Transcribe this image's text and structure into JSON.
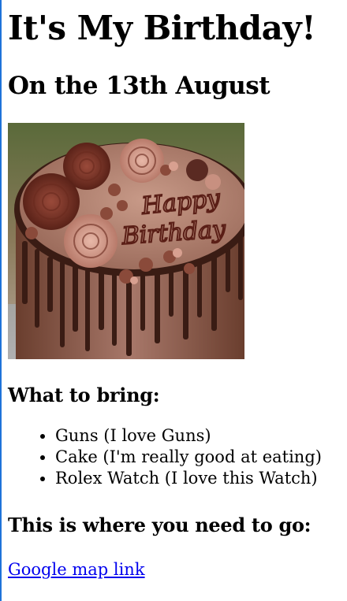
{
  "heading": "It's My Birthday!",
  "subheading": "On the 13th August",
  "image": {
    "name": "birthday-cake-image",
    "cake_text_line1": "Happy",
    "cake_text_line2": "Birthday"
  },
  "bring": {
    "title": "What to bring:",
    "items": [
      "Guns (I love Guns)",
      "Cake (I'm really good at eating)",
      "Rolex Watch (I love this Watch)"
    ]
  },
  "location": {
    "title": "This is where you need to go:",
    "link_text": "Google map link"
  },
  "colors": {
    "link": "#0000ee",
    "left_border": "#1e73d9",
    "frosting": "#9a6a5a",
    "chocolate_drip": "#3a1c14"
  }
}
